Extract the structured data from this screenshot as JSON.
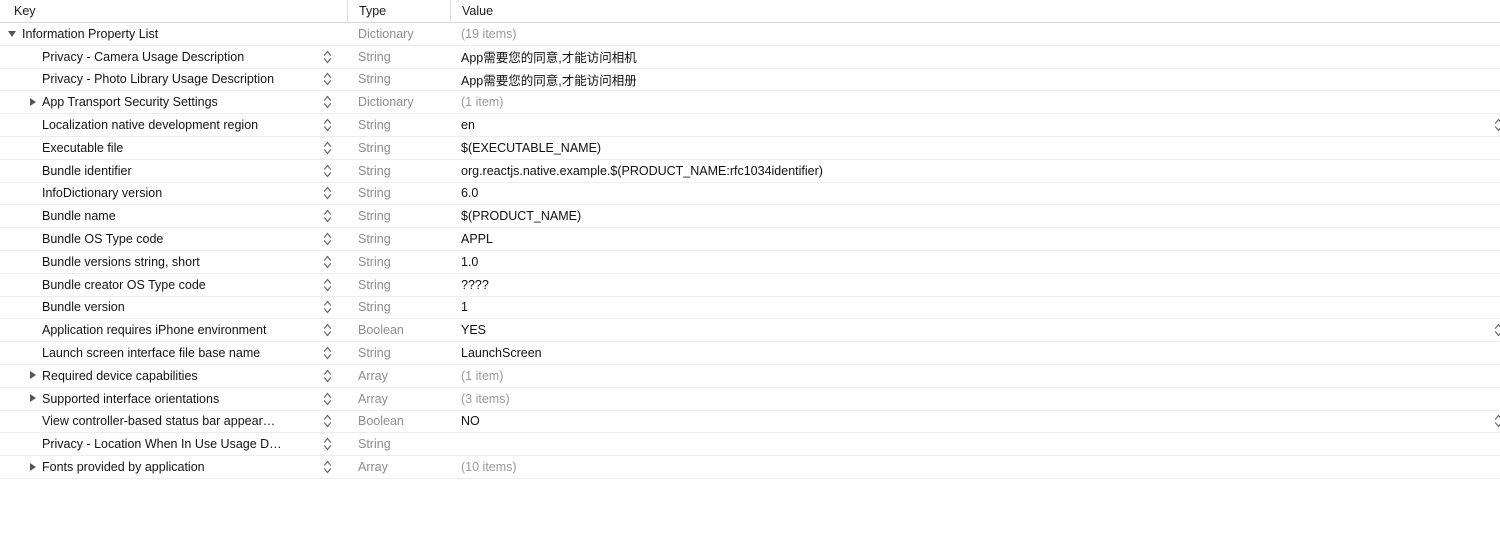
{
  "columns": {
    "key": "Key",
    "type": "Type",
    "value": "Value"
  },
  "colors": {
    "key_text": "#141414",
    "type_text": "#8d8d8d",
    "value_text": "#111111",
    "placeholder_text": "#9a9a9a",
    "row_separator": "#ededed",
    "header_separator": "#d6d6d6",
    "background": "#ffffff",
    "triangle": "#555555"
  },
  "rows": [
    {
      "key": "Information Property List",
      "type": "Dictionary",
      "value": "(19 items)",
      "depth": 0,
      "disclosure": "open",
      "stepper": false,
      "edge_stepper": false,
      "value_placeholder": true
    },
    {
      "key": "Privacy - Camera Usage Description",
      "type": "String",
      "value": "App需要您的同意,才能访问相机",
      "depth": 1,
      "disclosure": "none",
      "stepper": true,
      "edge_stepper": false,
      "value_placeholder": false
    },
    {
      "key": "Privacy - Photo Library Usage Description",
      "type": "String",
      "value": "App需要您的同意,才能访问相册",
      "depth": 1,
      "disclosure": "none",
      "stepper": true,
      "edge_stepper": false,
      "value_placeholder": false
    },
    {
      "key": "App Transport Security Settings",
      "type": "Dictionary",
      "value": "(1 item)",
      "depth": 1,
      "disclosure": "closed",
      "stepper": true,
      "edge_stepper": false,
      "value_placeholder": true
    },
    {
      "key": "Localization native development region",
      "type": "String",
      "value": "en",
      "depth": 1,
      "disclosure": "none",
      "stepper": true,
      "edge_stepper": true,
      "value_placeholder": false
    },
    {
      "key": "Executable file",
      "type": "String",
      "value": "$(EXECUTABLE_NAME)",
      "depth": 1,
      "disclosure": "none",
      "stepper": true,
      "edge_stepper": false,
      "value_placeholder": false
    },
    {
      "key": "Bundle identifier",
      "type": "String",
      "value": "org.reactjs.native.example.$(PRODUCT_NAME:rfc1034identifier)",
      "depth": 1,
      "disclosure": "none",
      "stepper": true,
      "edge_stepper": false,
      "value_placeholder": false
    },
    {
      "key": "InfoDictionary version",
      "type": "String",
      "value": "6.0",
      "depth": 1,
      "disclosure": "none",
      "stepper": true,
      "edge_stepper": false,
      "value_placeholder": false
    },
    {
      "key": "Bundle name",
      "type": "String",
      "value": "$(PRODUCT_NAME)",
      "depth": 1,
      "disclosure": "none",
      "stepper": true,
      "edge_stepper": false,
      "value_placeholder": false
    },
    {
      "key": "Bundle OS Type code",
      "type": "String",
      "value": "APPL",
      "depth": 1,
      "disclosure": "none",
      "stepper": true,
      "edge_stepper": false,
      "value_placeholder": false
    },
    {
      "key": "Bundle versions string, short",
      "type": "String",
      "value": "1.0",
      "depth": 1,
      "disclosure": "none",
      "stepper": true,
      "edge_stepper": false,
      "value_placeholder": false
    },
    {
      "key": "Bundle creator OS Type code",
      "type": "String",
      "value": "????",
      "depth": 1,
      "disclosure": "none",
      "stepper": true,
      "edge_stepper": false,
      "value_placeholder": false
    },
    {
      "key": "Bundle version",
      "type": "String",
      "value": "1",
      "depth": 1,
      "disclosure": "none",
      "stepper": true,
      "edge_stepper": false,
      "value_placeholder": false
    },
    {
      "key": "Application requires iPhone environment",
      "type": "Boolean",
      "value": "YES",
      "depth": 1,
      "disclosure": "none",
      "stepper": true,
      "edge_stepper": true,
      "value_placeholder": false
    },
    {
      "key": "Launch screen interface file base name",
      "type": "String",
      "value": "LaunchScreen",
      "depth": 1,
      "disclosure": "none",
      "stepper": true,
      "edge_stepper": false,
      "value_placeholder": false
    },
    {
      "key": "Required device capabilities",
      "type": "Array",
      "value": "(1 item)",
      "depth": 1,
      "disclosure": "closed",
      "stepper": true,
      "edge_stepper": false,
      "value_placeholder": true
    },
    {
      "key": "Supported interface orientations",
      "type": "Array",
      "value": "(3 items)",
      "depth": 1,
      "disclosure": "closed",
      "stepper": true,
      "edge_stepper": false,
      "value_placeholder": true
    },
    {
      "key": "View controller-based status bar appear…",
      "type": "Boolean",
      "value": "NO",
      "depth": 1,
      "disclosure": "none",
      "stepper": true,
      "edge_stepper": true,
      "value_placeholder": false
    },
    {
      "key": "Privacy - Location When In Use Usage D…",
      "type": "String",
      "value": "",
      "depth": 1,
      "disclosure": "none",
      "stepper": true,
      "edge_stepper": false,
      "value_placeholder": false
    },
    {
      "key": "Fonts provided by application",
      "type": "Array",
      "value": "(10 items)",
      "depth": 1,
      "disclosure": "closed",
      "stepper": true,
      "edge_stepper": false,
      "value_placeholder": true
    }
  ]
}
